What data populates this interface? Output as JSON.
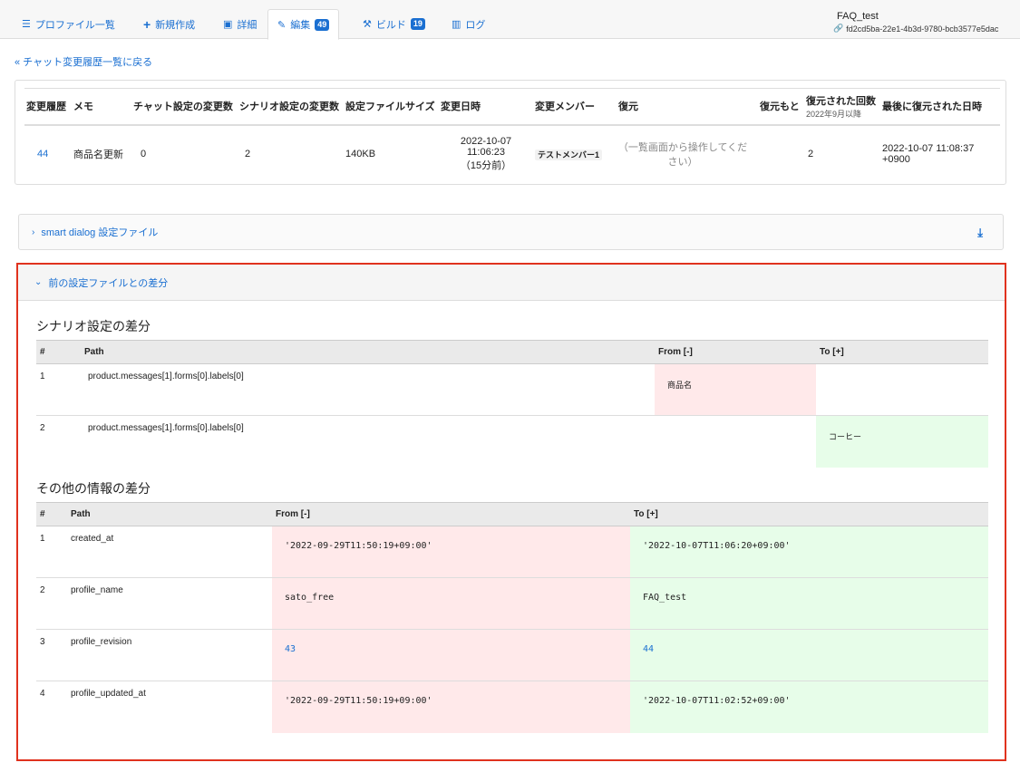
{
  "tabs": [
    {
      "icon": "list-icon",
      "glyph": "☰",
      "label": "プロファイル一覧"
    },
    {
      "icon": "plus-icon",
      "glyph": "+",
      "label": "新規作成"
    },
    {
      "icon": "document-icon",
      "glyph": "▣",
      "label": "詳細"
    },
    {
      "icon": "edit-icon",
      "glyph": "✎",
      "label": "編集",
      "badge": "49"
    },
    {
      "icon": "wrench-icon",
      "glyph": "⚒",
      "label": "ビルド",
      "badge": "19"
    },
    {
      "icon": "chart-icon",
      "glyph": "▥",
      "label": "ログ"
    }
  ],
  "profile": {
    "name": "FAQ_test",
    "id": "fd2cd5ba-22e1-4b3d-9780-bcb3577e5dac"
  },
  "back_link": "« チャット変更履歴一覧に戻る",
  "history": {
    "headers": {
      "revision": "変更履歴",
      "memo": "メモ",
      "chat_changes": "チャット設定の変更数",
      "scenario_changes": "シナリオ設定の変更数",
      "file_size": "設定ファイルサイズ",
      "changed_at": "変更日時",
      "member": "変更メンバー",
      "restore": "復元",
      "restore_source": "復元もと",
      "restore_count": "復元された回数",
      "restore_count_sub": "2022年9月以降",
      "last_restored": "最後に復元された日時"
    },
    "row": {
      "revision": "44",
      "memo": "商品名更新",
      "chat_changes": "0",
      "scenario_changes": "2",
      "file_size": "140KB",
      "changed_date": "2022-10-07",
      "changed_time": "11:06:23",
      "changed_ago": "（15分前）",
      "member": "テストメンバー1",
      "restore": "（一覧画面から操作してください）",
      "restore_source": "",
      "restore_count": "2",
      "last_restored": "2022-10-07 11:08:37 +0900"
    }
  },
  "panel_collapsed": {
    "chevron": "›",
    "label": "smart dialog 設定ファイル",
    "download_glyph": "⤓"
  },
  "diff_panel": {
    "chevron": "⌄",
    "label": "前の設定ファイルとの差分",
    "scenario": {
      "title": "シナリオ設定の差分",
      "headers": {
        "num": "#",
        "path": "Path",
        "from": "From [-]",
        "to": "To [+]"
      },
      "rows": [
        {
          "num": "1",
          "path": "product.messages[1].forms[0].labels[0]",
          "from": "商品名",
          "to": ""
        },
        {
          "num": "2",
          "path": "product.messages[1].forms[0].labels[0]",
          "from": "",
          "to": "コーヒー"
        }
      ]
    },
    "other": {
      "title": "その他の情報の差分",
      "headers": {
        "num": "#",
        "path": "Path",
        "from": "From [-]",
        "to": "To [+]"
      },
      "rows": [
        {
          "num": "1",
          "path": "created_at",
          "from": "'2022-09-29T11:50:19+09:00'",
          "to": "'2022-10-07T11:06:20+09:00'"
        },
        {
          "num": "2",
          "path": "profile_name",
          "from": "sato_free",
          "to": "FAQ_test"
        },
        {
          "num": "3",
          "path": "profile_revision",
          "from": "43",
          "to": "44"
        },
        {
          "num": "4",
          "path": "profile_updated_at",
          "from": "'2022-09-29T11:50:19+09:00'",
          "to": "'2022-10-07T11:02:52+09:00'"
        }
      ]
    }
  }
}
